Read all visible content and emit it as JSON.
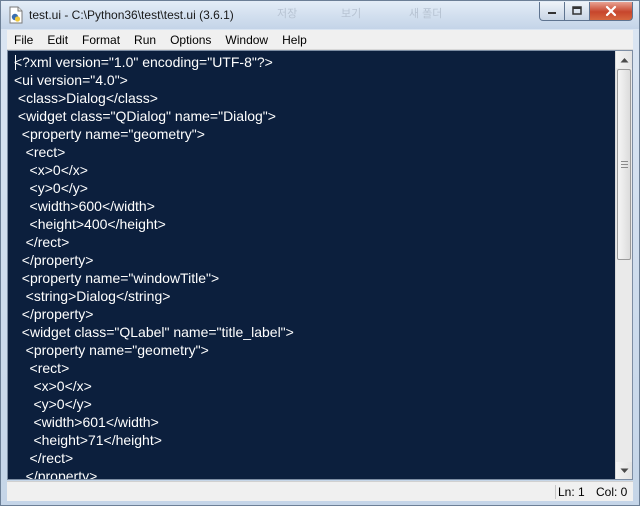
{
  "window": {
    "title": "test.ui - C:\\Python36\\test\\test.ui (3.6.1)",
    "ghost_labels": [
      "저장",
      "보기",
      "새 폴더"
    ]
  },
  "menubar": {
    "items": [
      "File",
      "Edit",
      "Format",
      "Run",
      "Options",
      "Window",
      "Help"
    ]
  },
  "editor": {
    "background": "#0c1f3d",
    "text_color": "#ffffff",
    "lines": [
      "<?xml version=\"1.0\" encoding=\"UTF-8\"?>",
      "<ui version=\"4.0\">",
      " <class>Dialog</class>",
      " <widget class=\"QDialog\" name=\"Dialog\">",
      "  <property name=\"geometry\">",
      "   <rect>",
      "    <x>0</x>",
      "    <y>0</y>",
      "    <width>600</width>",
      "    <height>400</height>",
      "   </rect>",
      "  </property>",
      "  <property name=\"windowTitle\">",
      "   <string>Dialog</string>",
      "  </property>",
      "  <widget class=\"QLabel\" name=\"title_label\">",
      "   <property name=\"geometry\">",
      "    <rect>",
      "     <x>0</x>",
      "     <y>0</y>",
      "     <width>601</width>",
      "     <height>71</height>",
      "    </rect>",
      "   </property>"
    ]
  },
  "statusbar": {
    "line": "Ln: 1",
    "column": "Col: 0"
  }
}
